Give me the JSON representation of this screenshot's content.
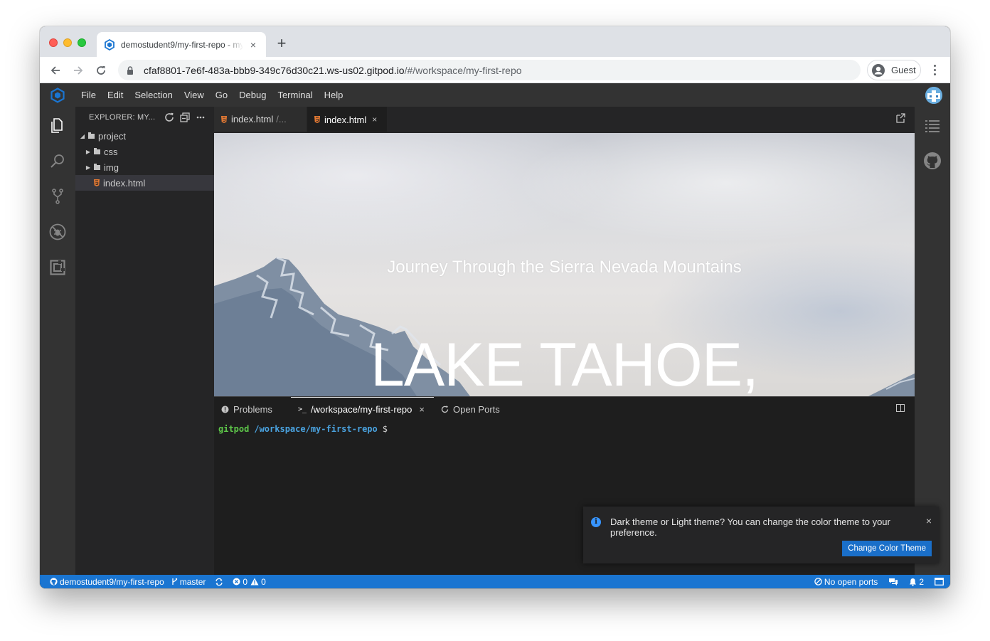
{
  "browser": {
    "tab_title": "demostudent9/my-first-repo - my-first-repo",
    "tab_close": "×",
    "new_tab": "+",
    "url_host": "cfaf8801-7e6f-483a-bbb9-349c76d30c21.ws-us02.gitpod.io",
    "url_path": "/#/workspace/my-first-repo",
    "profile_label": "Guest"
  },
  "menubar": {
    "items": [
      "File",
      "Edit",
      "Selection",
      "View",
      "Go",
      "Debug",
      "Terminal",
      "Help"
    ]
  },
  "activity_bar": {
    "icons": [
      "explorer-icon",
      "search-icon",
      "source-control-icon",
      "debug-icon",
      "extensions-icon"
    ]
  },
  "right_bar": {
    "icons": [
      "outline-icon",
      "github-icon"
    ]
  },
  "explorer": {
    "title": "EXPLORER: MY...",
    "tree": [
      {
        "label": "project",
        "type": "folder",
        "expanded": true
      },
      {
        "label": "css",
        "type": "folder",
        "expanded": false
      },
      {
        "label": "img",
        "type": "folder",
        "expanded": false
      },
      {
        "label": "index.html",
        "type": "file",
        "selected": true
      }
    ]
  },
  "editor": {
    "tabs": [
      {
        "label": "index.html",
        "description": "/...",
        "active": false
      },
      {
        "label": "index.html",
        "close": "×",
        "active": true
      }
    ]
  },
  "preview": {
    "subtitle": "Journey Through the Sierra Nevada Mountains",
    "title": "LAKE TAHOE,"
  },
  "panel": {
    "tabs": [
      {
        "label": "Problems",
        "icon": "info-circle-icon"
      },
      {
        "label": "/workspace/my-first-repo",
        "icon": "terminal-icon",
        "close": "×",
        "active": true
      },
      {
        "label": "Open Ports",
        "icon": "sync-icon"
      }
    ],
    "terminal": {
      "user": "gitpod",
      "path": "/workspace/my-first-repo",
      "prompt": "$"
    }
  },
  "notification": {
    "message": "Dark theme or Light theme? You can change the color theme to your preference.",
    "button": "Change Color Theme",
    "close": "×"
  },
  "statusbar": {
    "repo": "demostudent9/my-first-repo",
    "branch": "master",
    "errors": "0",
    "warnings": "0",
    "ports": "No open ports",
    "notifications": "2"
  },
  "colors": {
    "status_bar": "#1a75d1",
    "activity_bar": "#333333",
    "sidebar": "#252526",
    "editor": "#1e1e1e",
    "terminal_user": "#5ec84a",
    "terminal_path": "#4aa3e0"
  }
}
